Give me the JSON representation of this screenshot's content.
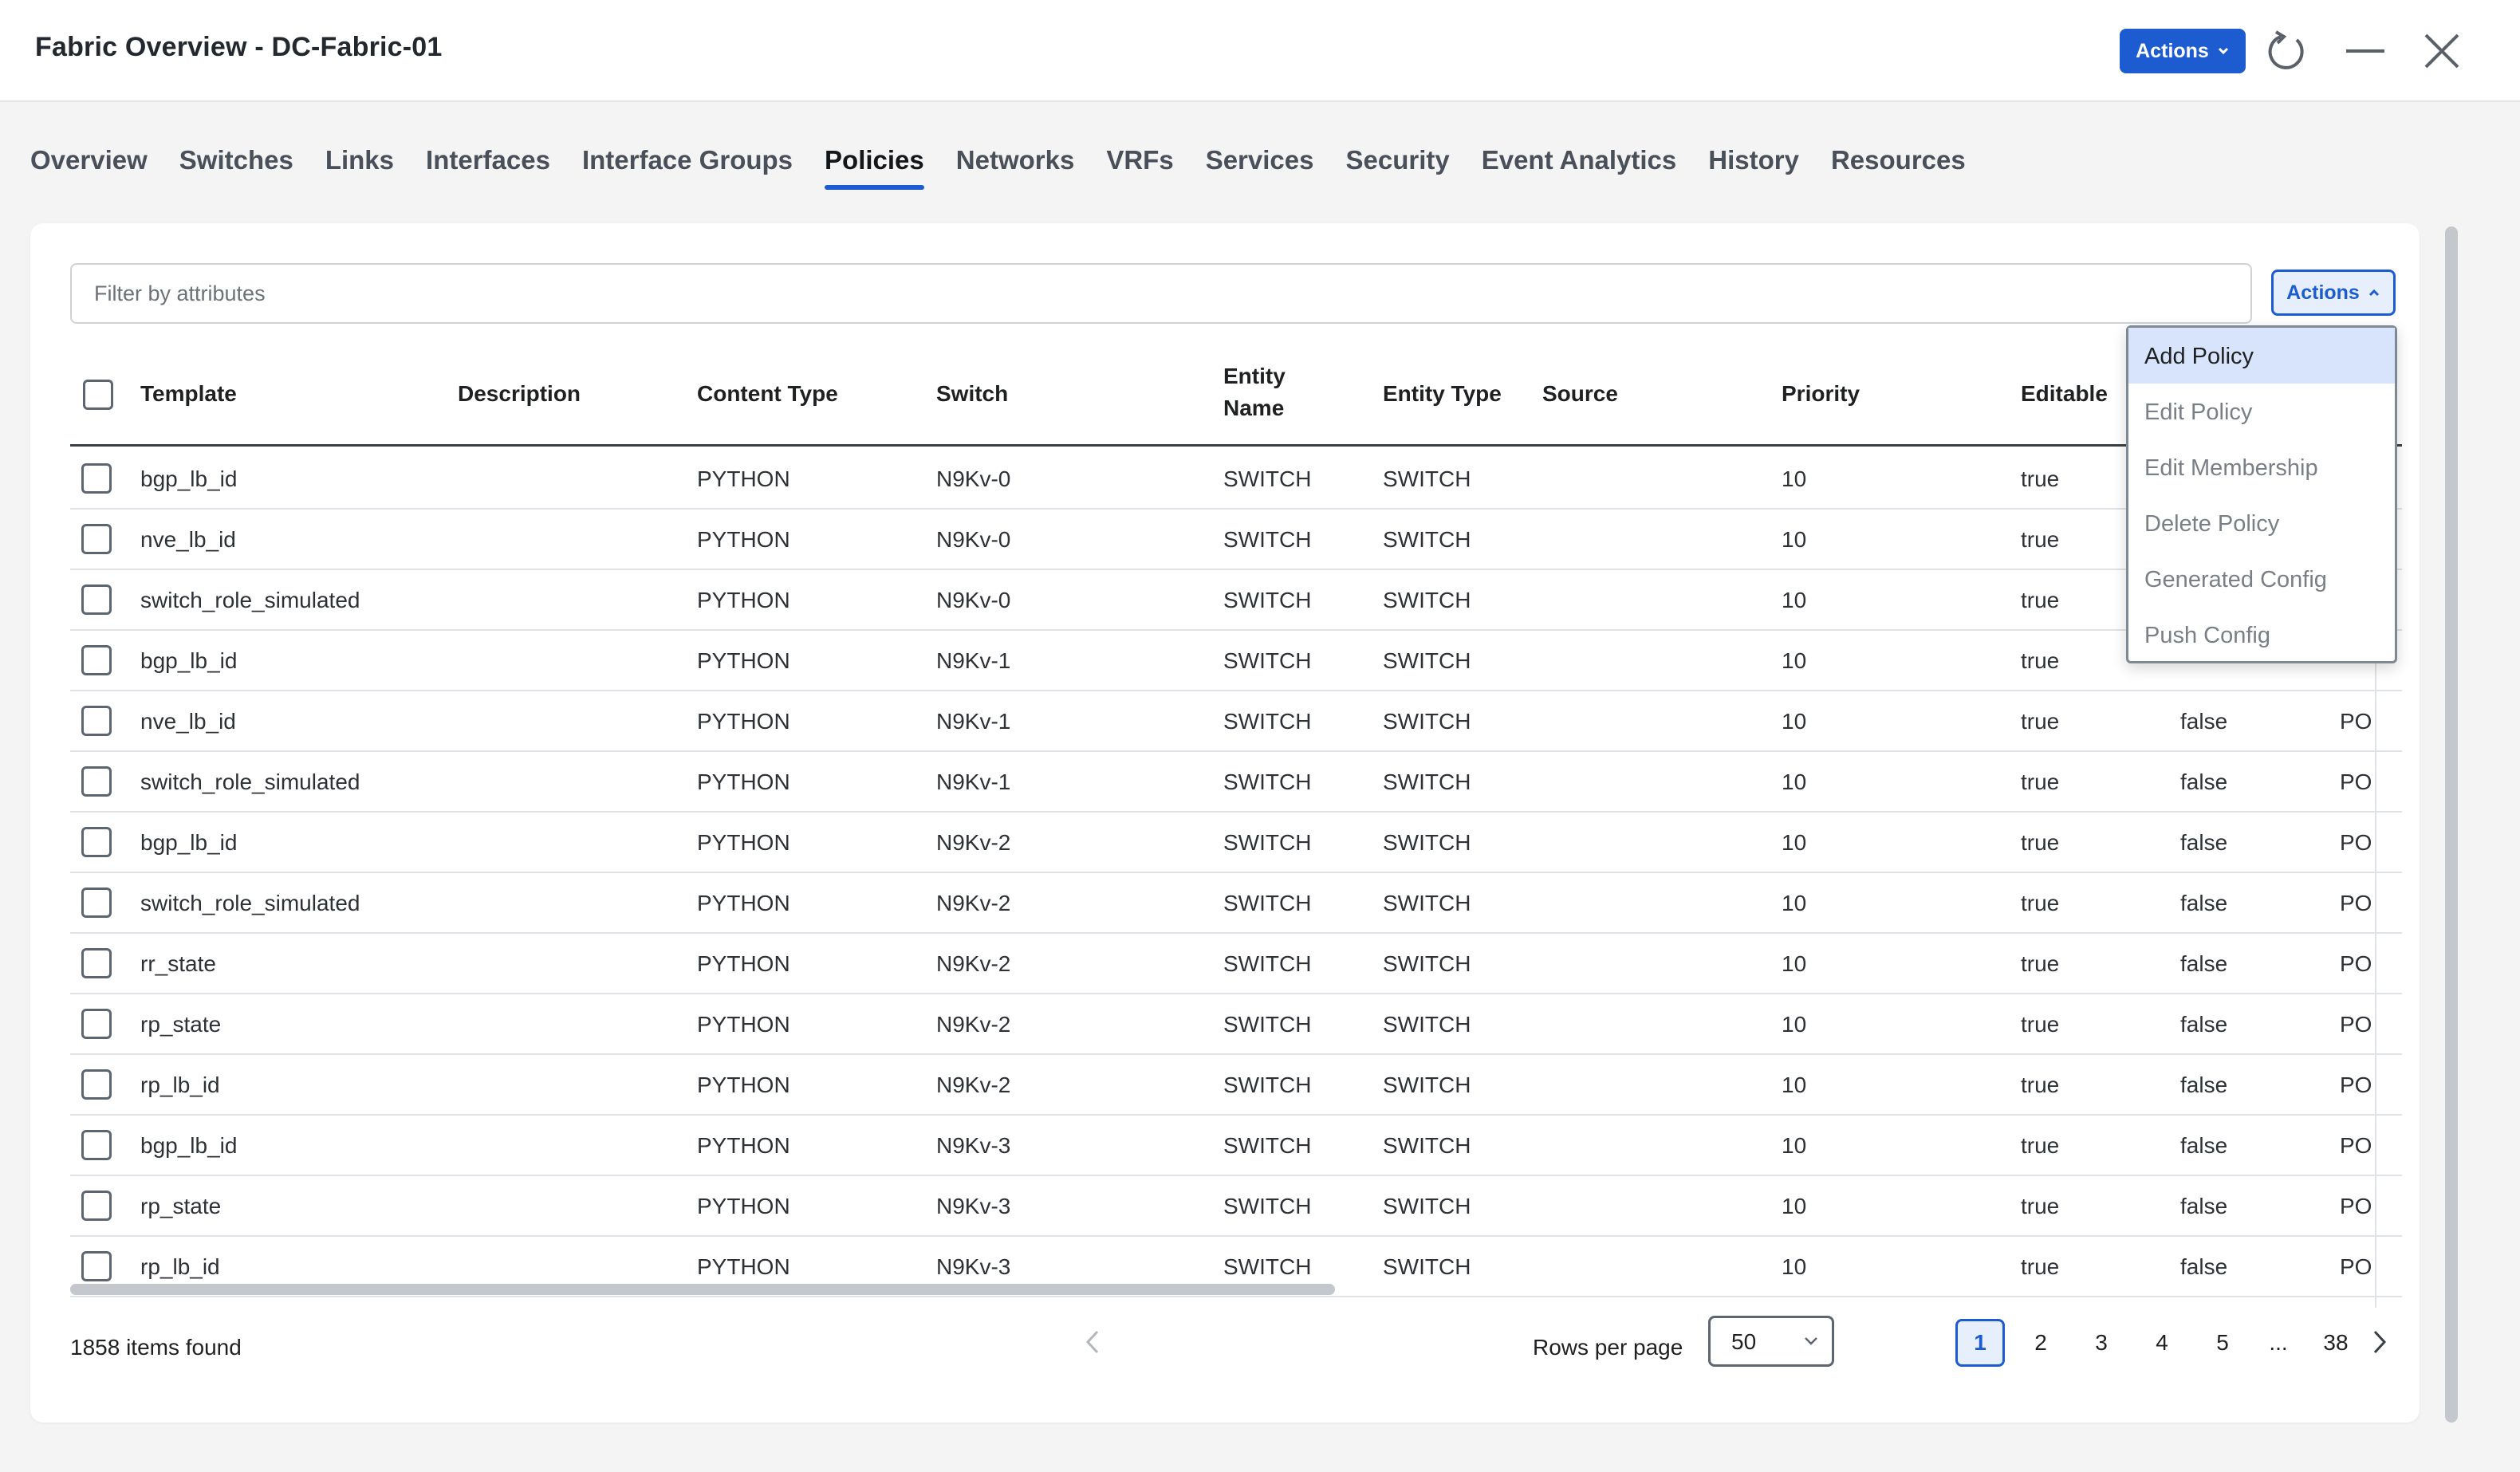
{
  "header": {
    "title": "Fabric Overview - DC-Fabric-01",
    "actions_label": "Actions"
  },
  "tabs": [
    {
      "label": "Overview"
    },
    {
      "label": "Switches"
    },
    {
      "label": "Links"
    },
    {
      "label": "Interfaces"
    },
    {
      "label": "Interface Groups"
    },
    {
      "label": "Policies",
      "active": true
    },
    {
      "label": "Networks"
    },
    {
      "label": "VRFs"
    },
    {
      "label": "Services"
    },
    {
      "label": "Security"
    },
    {
      "label": "Event Analytics"
    },
    {
      "label": "History"
    },
    {
      "label": "Resources"
    }
  ],
  "filter": {
    "placeholder": "Filter by attributes"
  },
  "table_actions_label": "Actions",
  "columns": {
    "template": "Template",
    "description": "Description",
    "content_type": "Content Type",
    "switch": "Switch",
    "entity_name_1": "Entity",
    "entity_name_2": "Name",
    "entity_type": "Entity Type",
    "source": "Source",
    "priority": "Priority",
    "editable": "Editable"
  },
  "rows": [
    {
      "template": "bgp_lb_id",
      "content_type": "PYTHON",
      "switch": "N9Kv-0",
      "entity_name": "SWITCH",
      "entity_type": "SWITCH",
      "priority": "10",
      "editable": "true",
      "col10": "",
      "col11": ""
    },
    {
      "template": "nve_lb_id",
      "content_type": "PYTHON",
      "switch": "N9Kv-0",
      "entity_name": "SWITCH",
      "entity_type": "SWITCH",
      "priority": "10",
      "editable": "true",
      "col10": "",
      "col11": ""
    },
    {
      "template": "switch_role_simulated",
      "content_type": "PYTHON",
      "switch": "N9Kv-0",
      "entity_name": "SWITCH",
      "entity_type": "SWITCH",
      "priority": "10",
      "editable": "true",
      "col10": "",
      "col11": ""
    },
    {
      "template": "bgp_lb_id",
      "content_type": "PYTHON",
      "switch": "N9Kv-1",
      "entity_name": "SWITCH",
      "entity_type": "SWITCH",
      "priority": "10",
      "editable": "true",
      "col10": "",
      "col11": ""
    },
    {
      "template": "nve_lb_id",
      "content_type": "PYTHON",
      "switch": "N9Kv-1",
      "entity_name": "SWITCH",
      "entity_type": "SWITCH",
      "priority": "10",
      "editable": "true",
      "col10": "false",
      "col11": "PO"
    },
    {
      "template": "switch_role_simulated",
      "content_type": "PYTHON",
      "switch": "N9Kv-1",
      "entity_name": "SWITCH",
      "entity_type": "SWITCH",
      "priority": "10",
      "editable": "true",
      "col10": "false",
      "col11": "PO"
    },
    {
      "template": "bgp_lb_id",
      "content_type": "PYTHON",
      "switch": "N9Kv-2",
      "entity_name": "SWITCH",
      "entity_type": "SWITCH",
      "priority": "10",
      "editable": "true",
      "col10": "false",
      "col11": "PO"
    },
    {
      "template": "switch_role_simulated",
      "content_type": "PYTHON",
      "switch": "N9Kv-2",
      "entity_name": "SWITCH",
      "entity_type": "SWITCH",
      "priority": "10",
      "editable": "true",
      "col10": "false",
      "col11": "PO"
    },
    {
      "template": "rr_state",
      "content_type": "PYTHON",
      "switch": "N9Kv-2",
      "entity_name": "SWITCH",
      "entity_type": "SWITCH",
      "priority": "10",
      "editable": "true",
      "col10": "false",
      "col11": "PO"
    },
    {
      "template": "rp_state",
      "content_type": "PYTHON",
      "switch": "N9Kv-2",
      "entity_name": "SWITCH",
      "entity_type": "SWITCH",
      "priority": "10",
      "editable": "true",
      "col10": "false",
      "col11": "PO"
    },
    {
      "template": "rp_lb_id",
      "content_type": "PYTHON",
      "switch": "N9Kv-2",
      "entity_name": "SWITCH",
      "entity_type": "SWITCH",
      "priority": "10",
      "editable": "true",
      "col10": "false",
      "col11": "PO"
    },
    {
      "template": "bgp_lb_id",
      "content_type": "PYTHON",
      "switch": "N9Kv-3",
      "entity_name": "SWITCH",
      "entity_type": "SWITCH",
      "priority": "10",
      "editable": "true",
      "col10": "false",
      "col11": "PO"
    },
    {
      "template": "rp_state",
      "content_type": "PYTHON",
      "switch": "N9Kv-3",
      "entity_name": "SWITCH",
      "entity_type": "SWITCH",
      "priority": "10",
      "editable": "true",
      "col10": "false",
      "col11": "PO"
    },
    {
      "template": "rp_lb_id",
      "content_type": "PYTHON",
      "switch": "N9Kv-3",
      "entity_name": "SWITCH",
      "entity_type": "SWITCH",
      "priority": "10",
      "editable": "true",
      "col10": "false",
      "col11": "PO"
    }
  ],
  "actions_menu": [
    "Add Policy",
    "Edit Policy",
    "Edit Membership",
    "Delete Policy",
    "Generated Config",
    "Push Config"
  ],
  "footer": {
    "items_found": "1858 items found",
    "rows_per_page_label": "Rows per page",
    "rows_per_page_value": "50",
    "pages": [
      "1",
      "2",
      "3",
      "4",
      "5",
      "...",
      "38"
    ],
    "current_page": "1"
  },
  "colors": {
    "accent": "#1d5cd0",
    "menu_highlight": "#d7e4fb"
  }
}
